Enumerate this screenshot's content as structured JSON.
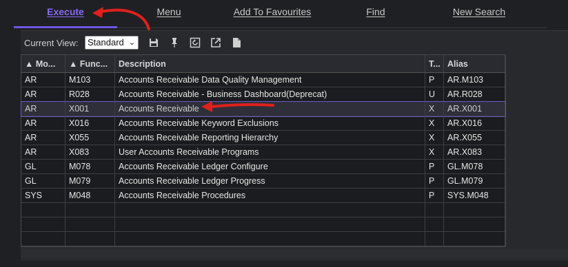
{
  "tabs": {
    "execute": "Execute",
    "menu": "Menu",
    "favourites": "Add To Favourites",
    "find": "Find",
    "new_search": "New Search"
  },
  "toolbar": {
    "view_label": "Current View:",
    "view_value": "Standard",
    "icons": [
      "save-icon",
      "pin-icon",
      "refresh-icon",
      "export-icon",
      "document-icon"
    ]
  },
  "grid": {
    "columns": [
      "▲ Mo...",
      "▲ Func...",
      "Description",
      "T...",
      "Alias"
    ],
    "rows": [
      [
        "AR",
        "M103",
        "Accounts Receivable Data Quality Management",
        "P",
        "AR.M103"
      ],
      [
        "AR",
        "R028",
        "Accounts Receivable - Business Dashboard(Deprecat)",
        "U",
        "AR.R028"
      ],
      [
        "AR",
        "X001",
        "Accounts Receivable",
        "X",
        "AR.X001"
      ],
      [
        "AR",
        "X016",
        "Accounts Receivable Keyword Exclusions",
        "X",
        "AR.X016"
      ],
      [
        "AR",
        "X055",
        "Accounts Receivable Reporting Hierarchy",
        "X",
        "AR.X055"
      ],
      [
        "AR",
        "X083",
        "User Accounts Receivable Programs",
        "X",
        "AR.X083"
      ],
      [
        "GL",
        "M078",
        "Accounts Receivable Ledger Configure",
        "P",
        "GL.M078"
      ],
      [
        "GL",
        "M079",
        "Accounts Receivable Ledger Progress",
        "P",
        "GL.M079"
      ],
      [
        "SYS",
        "M048",
        "Accounts Receivable Procedures",
        "P",
        "SYS.M048"
      ]
    ],
    "selected_row": 2,
    "empty_rows": 3
  },
  "colors": {
    "accent": "#7155e6",
    "annotation": "#e0201c"
  }
}
